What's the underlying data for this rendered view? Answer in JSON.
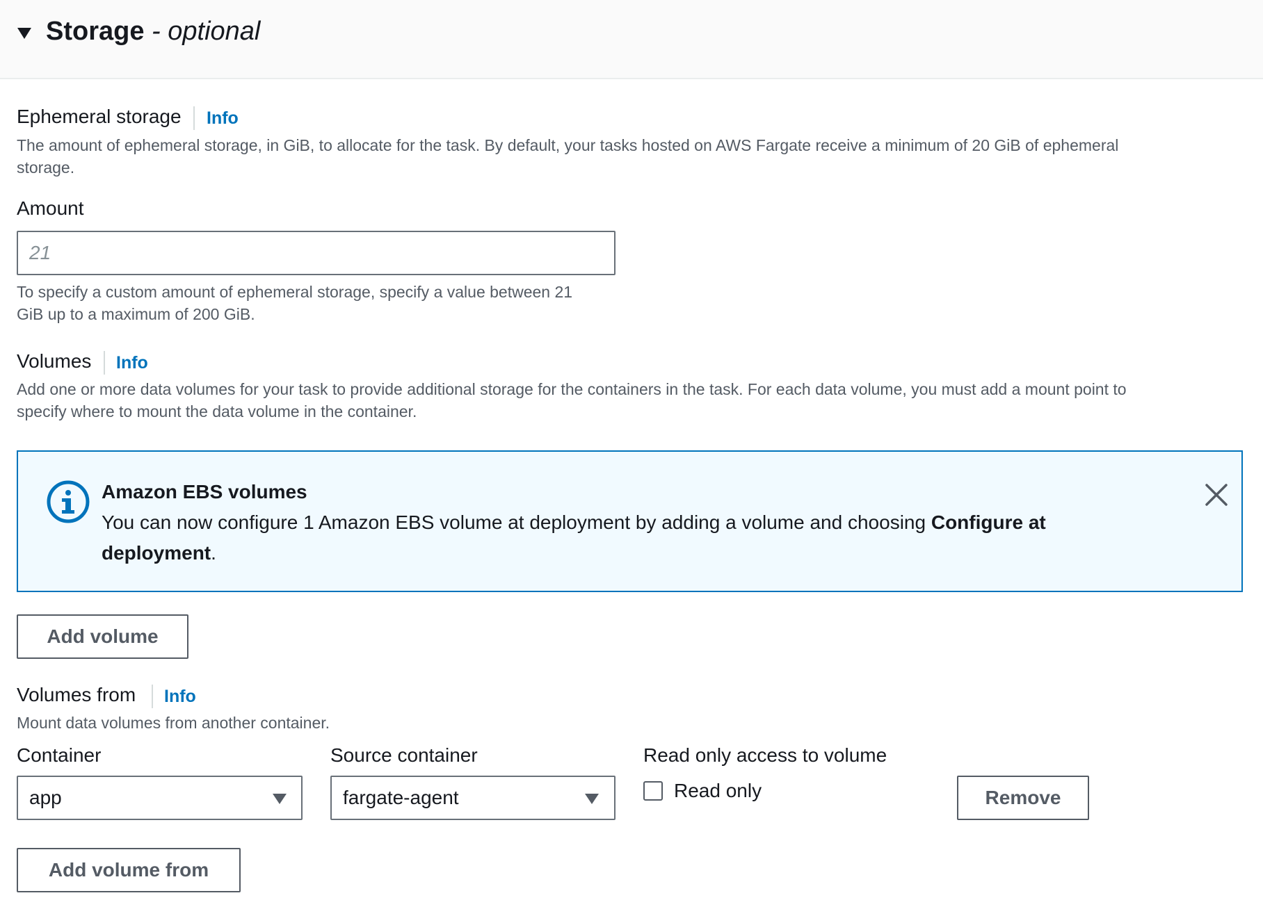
{
  "section": {
    "title": "Storage",
    "title_suffix": " - optional"
  },
  "ephemeral": {
    "label": "Ephemeral storage",
    "info": "Info",
    "description_line1": "The amount of ephemeral storage, in GiB, to allocate for the task. By default, your tasks hosted on AWS Fargate receive a minimum of 20 GiB of ephemeral",
    "description_line2": "storage.",
    "amount_label": "Amount",
    "amount_placeholder": "21",
    "amount_value": "",
    "hint_line1": "To specify a custom amount of ephemeral storage, specify a value between 21",
    "hint_line2": "GiB up to a maximum of 200 GiB."
  },
  "volumes": {
    "label": "Volumes",
    "info": "Info",
    "description_line1": "Add one or more data volumes for your task to provide additional storage for the containers in the task. For each data volume, you must add a mount point to",
    "description_line2": "specify where to mount the data volume in the container.",
    "alert": {
      "title": "Amazon EBS volumes",
      "body_prefix": "You can now configure 1 Amazon EBS volume at deployment by adding a volume and choosing ",
      "body_bold": "Configure at deployment",
      "body_suffix": ".",
      "icon": "info-circle-icon",
      "close_icon": "close-icon",
      "color": "#0073bb",
      "background": "#f1faff"
    },
    "add_button": "Add volume"
  },
  "volumes_from": {
    "label": "Volumes from",
    "info": "Info",
    "description": "Mount data volumes from another container.",
    "container_label": "Container",
    "container_value": "app",
    "source_label": "Source container",
    "source_value": "fargate-agent",
    "readonly_label": "Read only access to volume",
    "readonly_checkbox_label": "Read only",
    "readonly_checked": false,
    "remove_button": "Remove",
    "add_button": "Add volume from"
  },
  "colors": {
    "link": "#0073bb",
    "text": "#16191f",
    "secondary_text": "#545b64",
    "border": "#687078"
  }
}
